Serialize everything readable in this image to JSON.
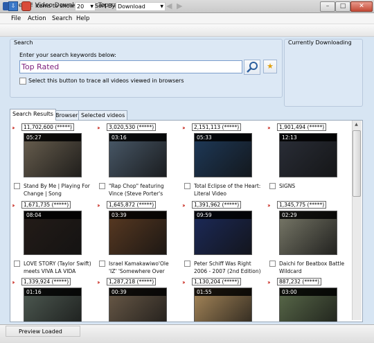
{
  "window": {
    "title": "HeyU! Video Downloader - Top rated",
    "buttons": {
      "minimize": "–",
      "maximize": "□",
      "close": "✕"
    }
  },
  "menu": [
    "File",
    "Action",
    "Search",
    "Help"
  ],
  "toolbar": {
    "items_label": "Items to show:",
    "items_value": "20",
    "sort_label": "Sort By:",
    "sort_value": "Download",
    "back": "◀",
    "forward": "▶",
    "download_icon": "⇩"
  },
  "search": {
    "legend": "Search",
    "prompt": "Enter your search keywords below:",
    "value": "Top Rated",
    "trace_label": "Select this button to trace all videos viewed in browsers",
    "fav_icon": "★"
  },
  "currently_downloading": {
    "legend": "Currently Downloading"
  },
  "tabs": [
    "Search Results",
    "Browser",
    "Selected videos"
  ],
  "videos": [
    {
      "views": "11,702,600 (*****)",
      "duration": "05:27",
      "title": "Stand By Me | Playing For Change | Song",
      "bg": "#6a6050"
    },
    {
      "views": "3,020,530 (*****)",
      "duration": "03:16",
      "title": "\"Rap Chop\" featuring Vince (Steve Porter's",
      "bg": "#4a5a6a"
    },
    {
      "views": "2,151,113 (*****)",
      "duration": "05:33",
      "title": "Total Eclipse of the Heart: Literal Video",
      "bg": "#1e3a5a"
    },
    {
      "views": "1,901,494 (*****)",
      "duration": "12:13",
      "title": "SIGNS",
      "bg": "#2a2e38"
    },
    {
      "views": "1,671,735 (*****)",
      "duration": "08:04",
      "title": "LOVE STORY (Taylor Swift) meets VIVA LA VIDA",
      "bg": "#241c18"
    },
    {
      "views": "1,645,872 (*****)",
      "duration": "03:39",
      "title": "Israel Kamakawiwo'Ole 'IZ' 'Somewhere Over",
      "bg": "#5a3a22"
    },
    {
      "views": "1,391,962 (*****)",
      "duration": "09:59",
      "title": "Peter Schiff Was Right 2006 - 2007 (2nd Edition)",
      "bg": "#1c2a5a"
    },
    {
      "views": "1,345,775 (*****)",
      "duration": "02:29",
      "title": "Daichi for Beatbox Battle Wildcard",
      "bg": "#7a7a6a"
    },
    {
      "views": "1,339,924 (*****)",
      "duration": "01:16",
      "title": "",
      "bg": "#4e5a52"
    },
    {
      "views": "1,287,218 (*****)",
      "duration": "00:39",
      "title": "",
      "bg": "#6a5a48"
    },
    {
      "views": "1,130,204 (*****)",
      "duration": "01:55",
      "title": "",
      "bg": "#a8885a"
    },
    {
      "views": "887,232 (*****)",
      "duration": "03:00",
      "title": "",
      "bg": "#5a6a4a"
    }
  ],
  "status": "Preview Loaded",
  "colors": {
    "accent": "#d7e5f3",
    "search_text": "#7b1c7b",
    "arrow": "#c8261c"
  }
}
